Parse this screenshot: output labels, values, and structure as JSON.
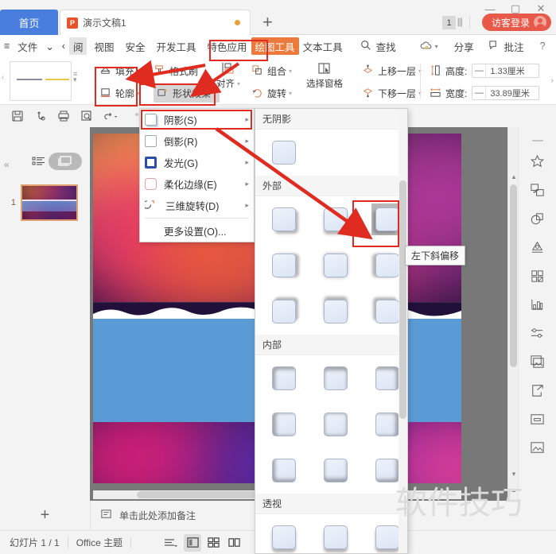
{
  "titlebar": {
    "home_tab": "首页",
    "doc_tab": "演示文稿1",
    "doc_tab_icon": "powerpoint-icon",
    "doc_icon_letter": "P",
    "new_tab": "+",
    "page_count": "1",
    "login_label": "访客登录",
    "minimize": "—",
    "maximize": "▢",
    "close": "✕"
  },
  "menubar": {
    "hamburger": "≡",
    "items": [
      {
        "label": "文件",
        "selected": false
      },
      {
        "label": "⌄",
        "selected": false
      },
      {
        "label": "‹",
        "selected": false
      },
      {
        "label": "阅",
        "selected": false
      },
      {
        "label": "视图",
        "selected": false
      },
      {
        "label": "安全",
        "selected": false
      },
      {
        "label": "开发工具",
        "selected": false
      },
      {
        "label": "特色应用",
        "selected": false
      },
      {
        "label": "绘图工具",
        "selected": true
      },
      {
        "label": "文本工具",
        "selected": false
      }
    ],
    "search": "查找",
    "share": "分享",
    "comment": "批注",
    "help": "?",
    "more": "⋮",
    "collapse": "⌃"
  },
  "ribbon": {
    "fill": "填充",
    "outline": "轮廓",
    "format_painter": "格式刷",
    "shape_effects": "形状效果",
    "align": "对齐",
    "group": "组合",
    "rotate": "旋转",
    "select_pane": "选择窗格",
    "bring_forward": "上移一层",
    "send_backward": "下移一层",
    "height_label": "高度:",
    "height_value": "1.33厘米",
    "width_label": "宽度:",
    "width_value": "33.89厘米",
    "minus": "—"
  },
  "quick_access": {
    "icons": [
      "save-icon",
      "undo-history-icon",
      "print-icon",
      "print-preview-icon",
      "undo-icon",
      "redo-icon"
    ]
  },
  "left_pane": {
    "collapse": "«",
    "outline_view_icon": "outline-view-icon",
    "slide_view_icon": "slide-view-icon",
    "thumbnail_number": "1"
  },
  "fx_menu": {
    "items": [
      {
        "label": "阴影(S)",
        "icon": "shadow-icon",
        "arrow": "▸",
        "highlighted": true
      },
      {
        "label": "倒影(R)",
        "icon": "reflection-icon",
        "arrow": "▸",
        "highlighted": false
      },
      {
        "label": "发光(G)",
        "icon": "glow-icon",
        "arrow": "▸",
        "highlighted": false
      },
      {
        "label": "柔化边缘(E)",
        "icon": "soft-edge-icon",
        "arrow": "▸",
        "highlighted": false
      },
      {
        "label": "三维旋转(D)",
        "icon": "3d-rotation-icon",
        "arrow": "▸",
        "highlighted": false
      }
    ],
    "more_settings": "更多设置(O)..."
  },
  "shadow_gallery": {
    "sections": [
      {
        "title": "无阴影",
        "rows": [
          [
            "none"
          ]
        ]
      },
      {
        "title": "外部",
        "rows": [
          [
            "bl",
            "b",
            "br"
          ],
          [
            "l",
            "c",
            "r"
          ],
          [
            "tl",
            "t",
            "tr"
          ]
        ]
      },
      {
        "title": "内部",
        "rows": [
          [
            "ibl",
            "ib",
            "ibr"
          ],
          [
            "il",
            "ic",
            "ir"
          ],
          [
            "itl",
            "it",
            "itr"
          ]
        ]
      },
      {
        "title": "透视",
        "rows": [
          [
            "p1",
            "p2",
            "p3"
          ]
        ]
      }
    ],
    "selected": "外部 / row1 / col3"
  },
  "tooltip": {
    "text": "左下斜偏移"
  },
  "notes": {
    "placeholder": "单击此处添加备注",
    "icon": "notes-icon"
  },
  "add_slide": {
    "label": "+"
  },
  "statusbar": {
    "slide_count": "幻灯片 1 / 1",
    "theme": "Office 主题",
    "view_normal_icon": "normal-view-icon",
    "view_sorter_icon": "slide-sorter-icon",
    "view_reading_icon": "reading-view-icon",
    "align_icon": "paragraph-icon"
  },
  "right_rail": {
    "icons": [
      "sparkle-icon",
      "shape-swap-icon",
      "shapes-icon",
      "text-art-icon",
      "grid-icon",
      "chart-icon",
      "sliders-icon",
      "image-gallery-icon",
      "share-export-icon",
      "box-icon",
      "picture-icon"
    ]
  },
  "watermark": {
    "text": "软件技巧"
  },
  "colors": {
    "accent_blue": "#4a7ede",
    "selected_tab_orange": "#ec7a3c",
    "annotation_red": "#e02b20",
    "slide_band_blue": "#5b9bd5",
    "login_red": "#e8594a"
  }
}
